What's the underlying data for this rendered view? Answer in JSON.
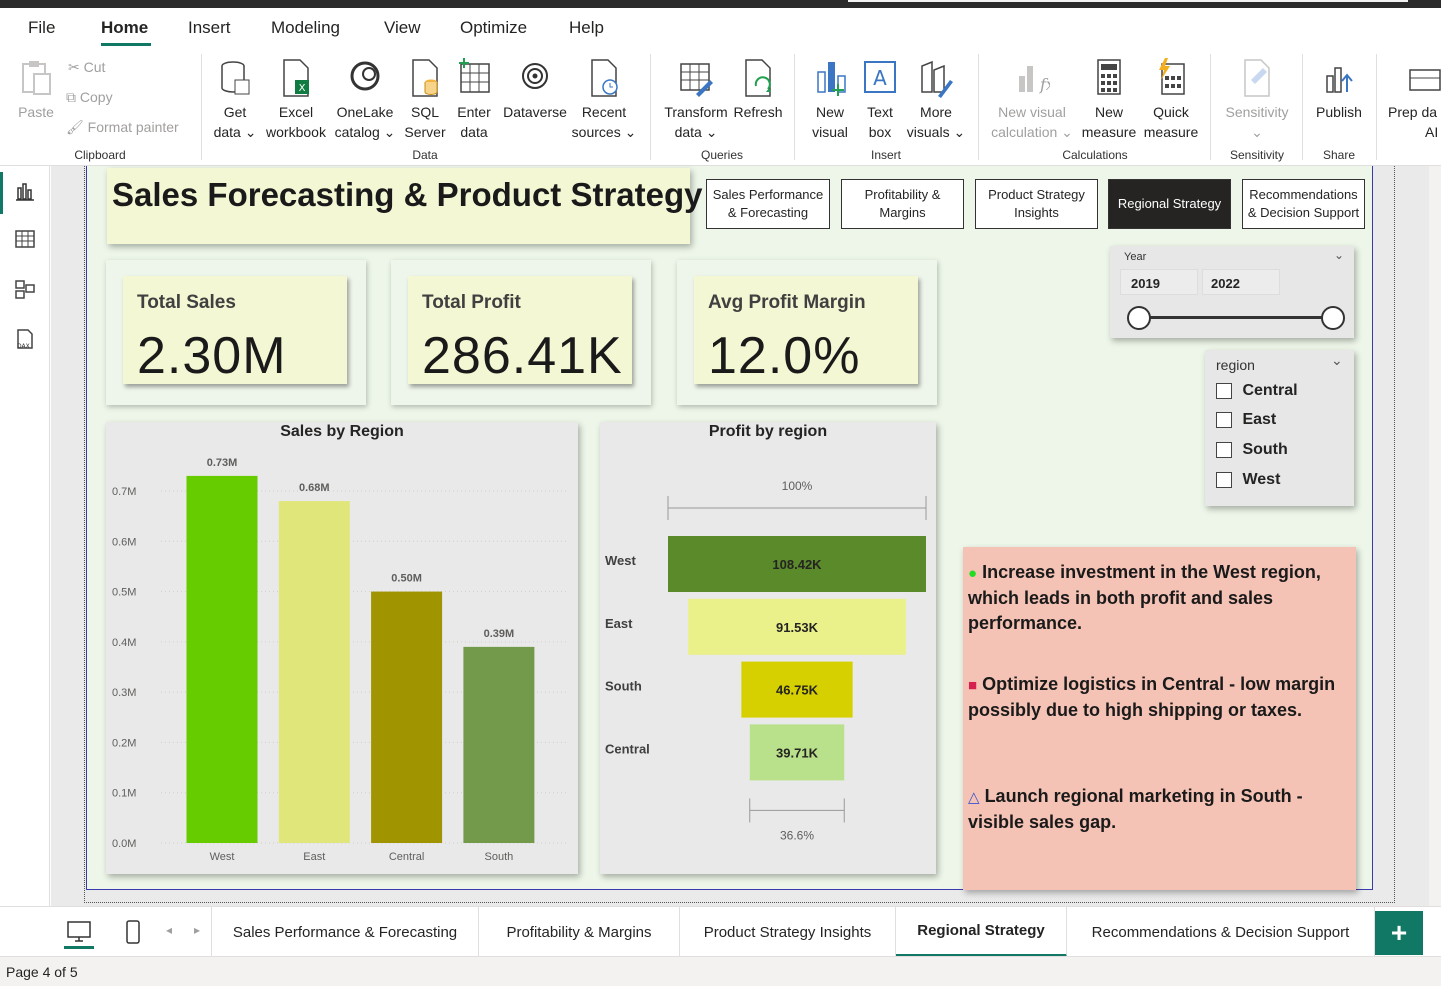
{
  "menu": {
    "items": [
      "File",
      "Home",
      "Insert",
      "Modeling",
      "View",
      "Optimize",
      "Help"
    ]
  },
  "ribbon": {
    "clipboard": {
      "paste": "Paste",
      "cut": "Cut",
      "copy": "Copy",
      "format_painter": "Format painter",
      "group": "Clipboard"
    },
    "data": {
      "get_data": [
        "Get",
        "data"
      ],
      "excel": [
        "Excel",
        "workbook"
      ],
      "onelake": [
        "OneLake",
        "catalog"
      ],
      "sql": [
        "SQL",
        "Server"
      ],
      "enter": [
        "Enter",
        "data"
      ],
      "dataverse": "Dataverse",
      "recent": [
        "Recent",
        "sources"
      ],
      "group": "Data"
    },
    "queries": {
      "transform": [
        "Transform",
        "data"
      ],
      "refresh": "Refresh",
      "group": "Queries"
    },
    "insert": {
      "new_visual": [
        "New",
        "visual"
      ],
      "text_box": [
        "Text",
        "box"
      ],
      "more_visuals": [
        "More",
        "visuals"
      ],
      "group": "Insert"
    },
    "calculations": {
      "new_visual_calc": [
        "New visual",
        "calculation"
      ],
      "new_measure": [
        "New",
        "measure"
      ],
      "quick_measure": [
        "Quick",
        "measure"
      ],
      "group": "Calculations"
    },
    "sensitivity": {
      "label": "Sensitivity",
      "group": "Sensitivity"
    },
    "share": {
      "publish": "Publish",
      "group": "Share"
    },
    "prep": {
      "label": [
        "Prep da",
        "AI"
      ]
    }
  },
  "report": {
    "title": "Sales Forecasting & Product Strategy",
    "nav_buttons": [
      {
        "line1": "Sales Performance",
        "line2": "& Forecasting"
      },
      {
        "line1": "Profitability &",
        "line2": "Margins"
      },
      {
        "line1": "Product Strategy",
        "line2": "Insights"
      },
      {
        "line1": "Regional Strategy",
        "line2": ""
      },
      {
        "line1": "Recommendations",
        "line2": "& Decision Support"
      }
    ],
    "kpis": {
      "total_sales": {
        "label": "Total Sales",
        "value": "2.30M"
      },
      "total_profit": {
        "label": "Total Profit",
        "value": "286.41K"
      },
      "avg_margin": {
        "label": "Avg Profit Margin",
        "value": "12.0%"
      }
    },
    "year_slicer": {
      "title": "Year",
      "from": "2019",
      "to": "2022"
    },
    "region_slicer": {
      "title": "region",
      "options": [
        "Central",
        "East",
        "South",
        "West"
      ]
    },
    "notes": [
      {
        "marker": "●",
        "marker_color": "#22dd22",
        "text": "Increase investment in the West region, which leads in both profit and sales performance."
      },
      {
        "marker": "■",
        "marker_color": "#d62050",
        "text": "Optimize logistics in Central - low margin possibly due to high shipping or taxes."
      },
      {
        "marker": "△",
        "marker_color": "#3355cc",
        "text": "Launch regional marketing in South - visible sales gap."
      }
    ]
  },
  "chart_data": [
    {
      "type": "bar",
      "title": "Sales by Region",
      "categories": [
        "West",
        "East",
        "Central",
        "South"
      ],
      "values": [
        0.73,
        0.68,
        0.5,
        0.39
      ],
      "value_labels": [
        "0.73M",
        "0.68M",
        "0.50M",
        "0.39M"
      ],
      "colors": [
        "#66cc00",
        "#e0e67a",
        "#a09400",
        "#729a4a"
      ],
      "yticks": [
        "0.0M",
        "0.1M",
        "0.2M",
        "0.3M",
        "0.4M",
        "0.5M",
        "0.6M",
        "0.7M"
      ],
      "ylim": [
        0,
        0.7
      ],
      "grid": true
    },
    {
      "type": "funnel",
      "title": "Profit by region",
      "categories": [
        "West",
        "East",
        "South",
        "Central"
      ],
      "values": [
        108.42,
        91.53,
        46.75,
        39.71
      ],
      "value_labels": [
        "108.42K",
        "91.53K",
        "46.75K",
        "39.71K"
      ],
      "colors": [
        "#5b8a2a",
        "#eaf08a",
        "#d6d000",
        "#b9e08a"
      ],
      "top_pct": "100%",
      "bottom_pct": "36.6%"
    }
  ],
  "tabs": {
    "pages": [
      "Sales Performance & Forecasting",
      "Profitability & Margins",
      "Product Strategy Insights",
      "Regional Strategy",
      "Recommendations & Decision Support"
    ],
    "selected": 3,
    "add": "+"
  },
  "status": {
    "page": "Page 4 of 5"
  }
}
